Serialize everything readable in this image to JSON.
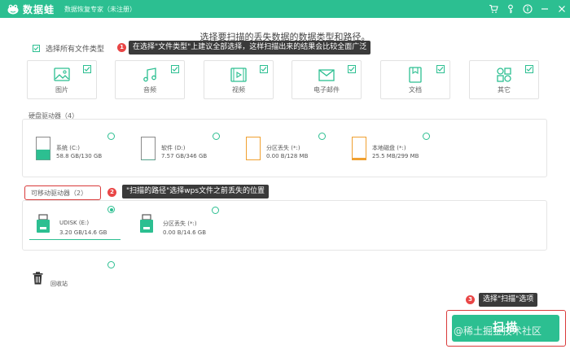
{
  "app": {
    "name": "数据蛙",
    "subtitle": "数据恢复专家（未注册）"
  },
  "titlebar_icons": [
    "cart-icon",
    "key-icon",
    "info-icon",
    "minimize-icon",
    "close-icon"
  ],
  "heading": "选择要扫描的丢失数据的数据类型和路径。",
  "select_all": {
    "label": "选择所有文件类型",
    "checked": true
  },
  "callouts": [
    {
      "badge": "1",
      "text": "在选择\"文件类型\"上建议全部选择，这样扫描出来的结果会比较全面广泛"
    },
    {
      "badge": "2",
      "text": "\"扫描的路径\"选择wps文件之前丢失的位置"
    },
    {
      "badge": "3",
      "text": "选择\"扫描\"选项"
    }
  ],
  "file_types": [
    {
      "label": "图片",
      "icon": "image-icon",
      "checked": true
    },
    {
      "label": "音频",
      "icon": "music-icon",
      "checked": true
    },
    {
      "label": "视频",
      "icon": "video-icon",
      "checked": true
    },
    {
      "label": "电子邮件",
      "icon": "mail-icon",
      "checked": true
    },
    {
      "label": "文档",
      "icon": "document-icon",
      "checked": true
    },
    {
      "label": "其它",
      "icon": "other-icon",
      "checked": true
    }
  ],
  "hard_drives": {
    "title": "硬盘驱动器（4）",
    "items": [
      {
        "name": "系统 (C:)",
        "size": "58.8 GB/130 GB",
        "fill_fraction": 0.45,
        "color": "#2cbf91",
        "selected": false
      },
      {
        "name": "软件 (D:)",
        "size": "7.57 GB/346 GB",
        "fill_fraction": 0.02,
        "color": "#2cbf91",
        "selected": false
      },
      {
        "name": "分区丢失 (*:)",
        "size": "0.00  B/128 MB",
        "fill_fraction": 0.0,
        "color": "#f0a030",
        "selected": false
      },
      {
        "name": "本地磁盘 (*:)",
        "size": "25.5 MB/299 MB",
        "fill_fraction": 0.09,
        "color": "#f0a030",
        "selected": false
      }
    ]
  },
  "removable_drives": {
    "title": "可移动驱动器（2）",
    "items": [
      {
        "name": "UDISK (E:)",
        "size": "3.20 GB/14.6 GB",
        "selected": true
      },
      {
        "name": "分区丢失 (*:)",
        "size": "0.00  B/14.6 GB",
        "selected": false
      }
    ]
  },
  "recycle_bin": {
    "label": "回收站",
    "selected": false
  },
  "scan_button": {
    "label": "扫描"
  },
  "watermark": "@稀土掘金技术社区",
  "colors": {
    "accent": "#2cbf91",
    "callout_bg": "#3a3a3a",
    "badge": "#e94646",
    "highlight": "#d93a3a"
  }
}
